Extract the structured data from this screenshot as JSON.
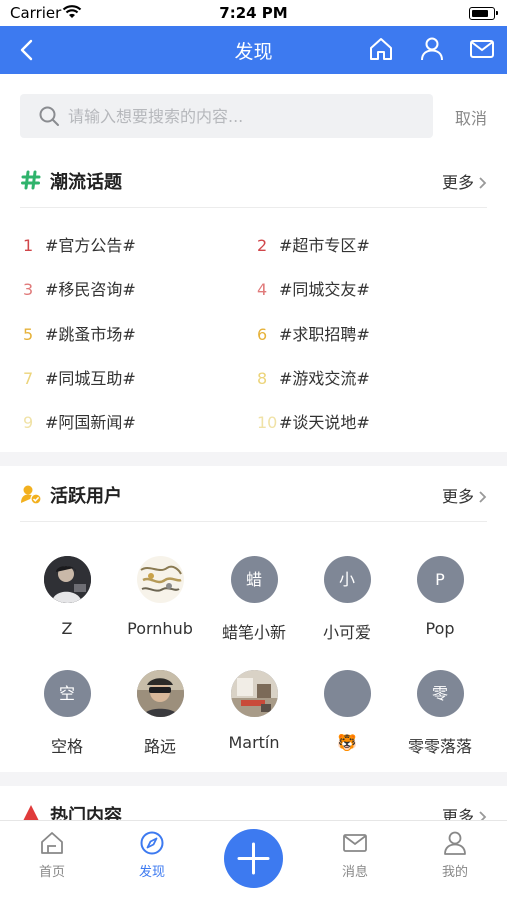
{
  "status_bar": {
    "carrier": "Carrier",
    "time": "7:24 PM"
  },
  "nav": {
    "title": "发现"
  },
  "search": {
    "placeholder": "请输入想要搜索的内容...",
    "cancel_label": "取消"
  },
  "trending": {
    "title": "潮流话题",
    "more_label": "更多",
    "icon_color": "#2fb36b",
    "items": [
      {
        "rank": "1",
        "name": "#官方公告#",
        "color": "#d0464a"
      },
      {
        "rank": "2",
        "name": "#超市专区#",
        "color": "#d0464a"
      },
      {
        "rank": "3",
        "name": "#移民咨询#",
        "color": "#e07a7a"
      },
      {
        "rank": "4",
        "name": "#同城交友#",
        "color": "#e07a7a"
      },
      {
        "rank": "5",
        "name": "#跳蚤市场#",
        "color": "#e6b23a"
      },
      {
        "rank": "6",
        "name": "#求职招聘#",
        "color": "#e6b23a"
      },
      {
        "rank": "7",
        "name": "#同城互助#",
        "color": "#ecd47a"
      },
      {
        "rank": "8",
        "name": "#游戏交流#",
        "color": "#ecd47a"
      },
      {
        "rank": "9",
        "name": "#阿国新闻#",
        "color": "#f0e2a6"
      },
      {
        "rank": "10",
        "name": "#谈天说地#",
        "color": "#f0e2a6"
      }
    ]
  },
  "active_users": {
    "title": "活跃用户",
    "more_label": "更多",
    "icon_color": "#f2b01e",
    "users": [
      {
        "name": "Z",
        "initial": "",
        "photo": "dark"
      },
      {
        "name": "Pornhub",
        "initial": "",
        "photo": "sketch"
      },
      {
        "name": "蜡笔小新",
        "initial": "蜡",
        "photo": ""
      },
      {
        "name": "小可爱",
        "initial": "小",
        "photo": ""
      },
      {
        "name": "Pop",
        "initial": "P",
        "photo": ""
      },
      {
        "name": "空格",
        "initial": "空",
        "photo": ""
      },
      {
        "name": "路远",
        "initial": "",
        "photo": "person"
      },
      {
        "name": "Martín",
        "initial": "",
        "photo": "room"
      },
      {
        "name": "🐯",
        "initial": "",
        "photo": ""
      },
      {
        "name": "零零落落",
        "initial": "零",
        "photo": ""
      }
    ]
  },
  "hot_content": {
    "title": "热门内容",
    "more_label": "更多",
    "icon_color": "#e03b3b"
  },
  "tab_bar": {
    "active_color": "#3d7af0",
    "inactive_color": "#888888",
    "tabs": [
      {
        "label": "首页"
      },
      {
        "label": "发现"
      },
      {
        "label": "消息"
      },
      {
        "label": "我的"
      }
    ]
  }
}
